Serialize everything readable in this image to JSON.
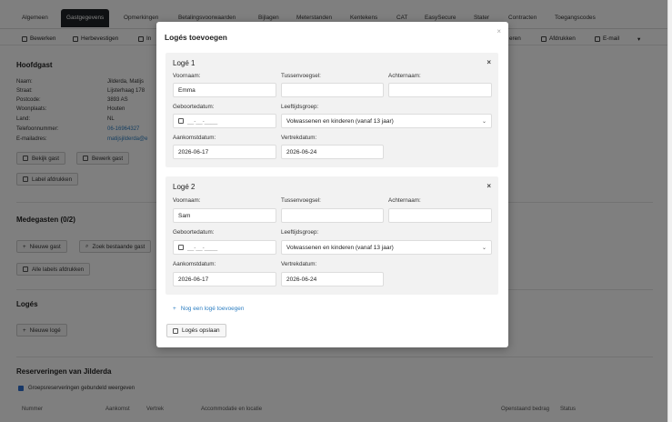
{
  "tabs": [
    "Algemeen",
    "Gastgegevens",
    "Opmerkingen",
    "Betalingsvoorwaarden",
    "Bijlagen",
    "Meterstanden",
    "Kentekens",
    "CAT",
    "EasySecure",
    "Stater",
    "Contracten",
    "Toegangscodes"
  ],
  "toolbar": {
    "edit": "Bewerken",
    "reconfirm": "Herbevestigen",
    "info": "In",
    "print_prefix": "eren",
    "print": "Afdrukken",
    "email": "E-mail",
    "more": "▾"
  },
  "hoofdgast": {
    "title": "Hoofdgast",
    "rows": [
      {
        "label": "Naam:",
        "value": "Jilderda, Matijs"
      },
      {
        "label": "Straat:",
        "value": "Lijsterhaag 178"
      },
      {
        "label": "Postcode:",
        "value": "3893 AS"
      },
      {
        "label": "Woonplaats:",
        "value": "Houten"
      },
      {
        "label": "Land:",
        "value": "NL"
      },
      {
        "label": "Telefoonnummer:",
        "value": "06-16964327"
      },
      {
        "label": "E-mailadres:",
        "value": "matijsjilderda@e"
      }
    ],
    "buttons": {
      "view": "Bekijk gast",
      "edit": "Bewerk gast",
      "label": "Label afdrukken"
    }
  },
  "medegasten": {
    "title": "Medegasten (0/2)",
    "new": "Nieuwe gast",
    "search": "Zoek bestaande gast",
    "print_all": "Alle labels afdrukken"
  },
  "loges_section": {
    "title": "Logés",
    "new": "Nieuwe logé"
  },
  "reservations": {
    "title": "Reserveringen van Jilderda",
    "group_label": "Groepsreserveringen gebundeld weergeven",
    "columns": [
      "Nummer",
      "Aankomst",
      "Vertrek",
      "Accommodatie en locatie",
      "Openstaand bedrag",
      "Status"
    ]
  },
  "modal": {
    "title": "Logés toevoegen",
    "close": "×",
    "labels": {
      "first": "Voornaam:",
      "middle": "Tussenvoegsel:",
      "last": "Achternaam:",
      "birth": "Geboortedatum:",
      "age": "Leeftijdsgroep:",
      "arrival": "Aankomstdatum:",
      "departure": "Vertrekdatum:"
    },
    "date_placeholder": "__-__-____",
    "guests": [
      {
        "title": "Logé 1",
        "first": "Emma",
        "middle": "",
        "last": "",
        "age_group": "Volwassenen en kinderen (vanaf 13 jaar)",
        "arrival": "2026-06-17",
        "departure": "2026-06-24"
      },
      {
        "title": "Logé 2",
        "first": "Sam",
        "middle": "",
        "last": "",
        "age_group": "Volwassenen en kinderen (vanaf 13 jaar)",
        "arrival": "2026-06-17",
        "departure": "2026-06-24"
      }
    ],
    "add_link": "Nog een logé toevoegen",
    "save": "Logés opslaan"
  }
}
